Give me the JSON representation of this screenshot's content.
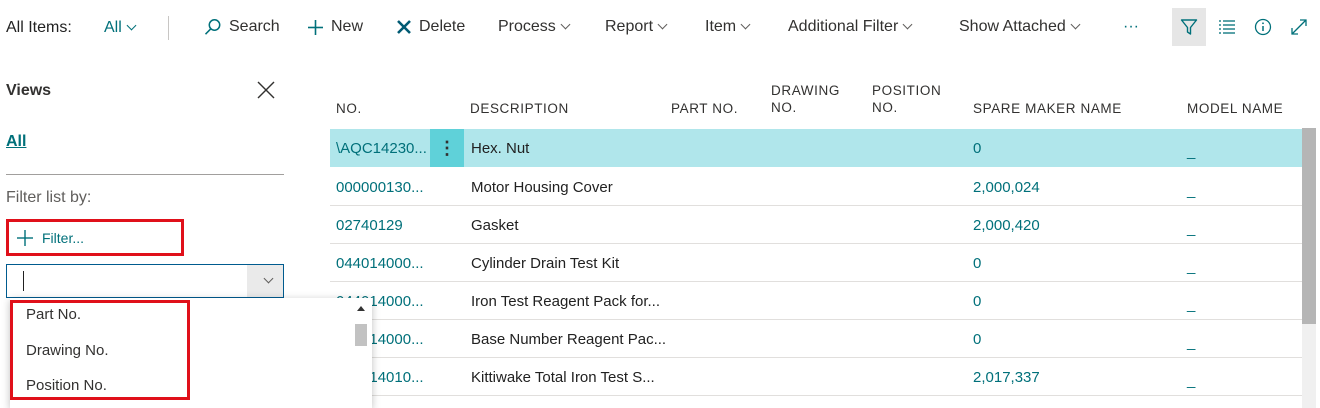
{
  "toolbar": {
    "title": "All Items:",
    "view_selector": "All",
    "actions": [
      "Search",
      "New",
      "Delete",
      "Process",
      "Report",
      "Item",
      "Additional Filter",
      "Show Attached"
    ],
    "more": "···"
  },
  "filter_pane": {
    "title": "Views",
    "all_view": "All",
    "filter_list_by": "Filter list by:",
    "add_filter": "Filter...",
    "input_value": "",
    "options": [
      "Part No.",
      "Drawing No.",
      "Position No."
    ]
  },
  "grid": {
    "headers": {
      "no": "NO.",
      "description": "DESCRIPTION",
      "part_no": "PART NO.",
      "drawing_no_1": "DRAWING",
      "drawing_no_2": "NO.",
      "position_no_1": "POSITION",
      "position_no_2": "NO.",
      "spare_maker": "SPARE MAKER NAME",
      "model_name": "MODEL NAME"
    },
    "rows": [
      {
        "no": "\\AQC14230...",
        "description": "Hex. Nut",
        "spare_maker": "0",
        "model": "_"
      },
      {
        "no": "000000130...",
        "description": "Motor Housing Cover",
        "spare_maker": "2,000,024",
        "model": "_"
      },
      {
        "no": "02740129",
        "description": "Gasket",
        "spare_maker": "2,000,420",
        "model": "_"
      },
      {
        "no": "044014000...",
        "description": "Cylinder Drain Test Kit",
        "spare_maker": "0",
        "model": "_"
      },
      {
        "no": "044014000...",
        "description": "Iron Test Reagent Pack for...",
        "spare_maker": "0",
        "model": "_"
      },
      {
        "no": "044014000...",
        "description": "Base Number Reagent Pac...",
        "spare_maker": "0",
        "model": "_"
      },
      {
        "no": "044014010...",
        "description": "Kittiwake Total Iron Test S...",
        "spare_maker": "2,017,337",
        "model": "_"
      }
    ]
  },
  "colors": {
    "accent": "#00707a",
    "selected_row": "#b0e6eb",
    "highlight_box": "#e0101a"
  }
}
